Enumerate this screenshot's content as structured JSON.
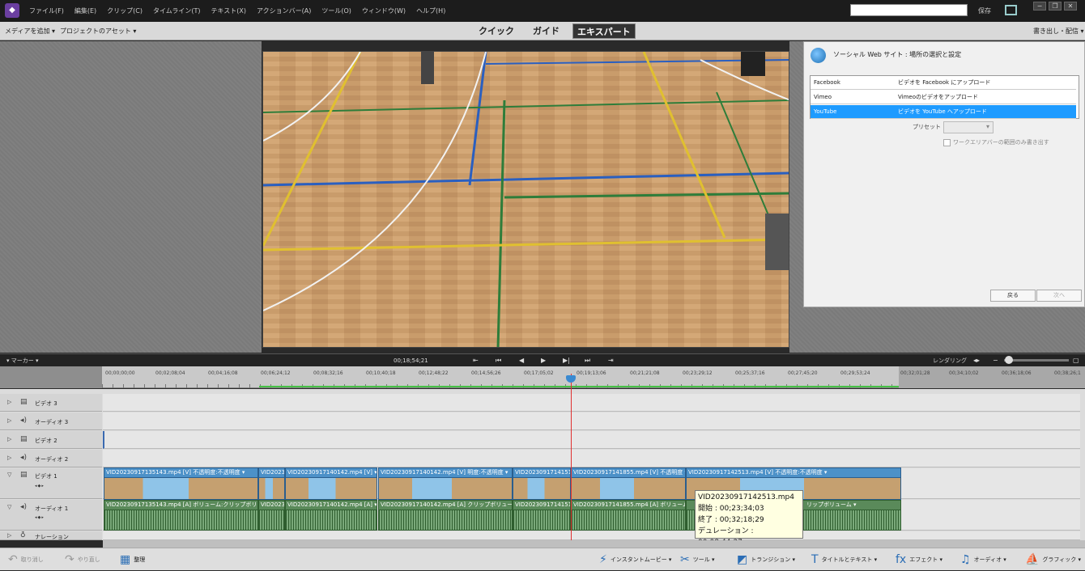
{
  "menubar": {
    "menus": [
      "ファイル(F)",
      "編集(E)",
      "クリップ(C)",
      "タイムライン(T)",
      "テキスト(X)",
      "アクションバー(A)",
      "ツール(O)",
      "ウィンドウ(W)",
      "ヘルプ(H)"
    ],
    "save_label": "保存"
  },
  "toolbar2": {
    "add_media": "メディアを追加 ▾",
    "project_assets": "プロジェクトのアセット ▾",
    "tabs": [
      "クイック",
      "ガイド",
      "エキスパート"
    ],
    "active_tab": "エキスパート",
    "export_share": "書き出し・配信 ▾"
  },
  "export_panel": {
    "title": "ソーシャル Web サイト : 場所の選択と設定",
    "sites": [
      {
        "name": "Facebook",
        "desc": "ビデオを Facebook にアップロード"
      },
      {
        "name": "Vimeo",
        "desc": "Vimeoのビデオをアップロード"
      },
      {
        "name": "YouTube",
        "desc": "ビデオを YouTube へアップロード"
      }
    ],
    "preset_label": "プリセット :",
    "workarea_label": "ワークエリアバーの範囲のみ書き出す",
    "back": "戻る",
    "next": "次へ"
  },
  "timeline_bar": {
    "marker": "▾ マーカー ▾",
    "timecode": "00;18;54;21",
    "render": "レンダリング"
  },
  "ruler": {
    "ticks": [
      "00;00;00;00",
      "00;02;08;04",
      "00;04;16;08",
      "00;06;24;12",
      "00;08;32;16",
      "00;10;40;18",
      "00;12;48;22",
      "00;14;56;26",
      "00;17;05;02",
      "00;19;13;06",
      "00;21;21;08",
      "00;23;29;12",
      "00;25;37;16",
      "00;27;45;20",
      "00;29;53;24",
      "00;32;01;28",
      "00;34;10;02",
      "00;36;18;06",
      "00;38;26;1"
    ]
  },
  "tracks": [
    {
      "label": "ビデオ 3",
      "type": "video"
    },
    {
      "label": "オーディオ 3",
      "type": "audio"
    },
    {
      "label": "ビデオ 2",
      "type": "video"
    },
    {
      "label": "オーディオ 2",
      "type": "audio"
    },
    {
      "label": "ビデオ 1",
      "type": "video"
    },
    {
      "label": "オーディオ 1",
      "type": "audio"
    },
    {
      "label": "ナレーション",
      "type": "narration"
    }
  ],
  "video_clips": [
    "VID20230917135143.mp4 [V] 不透明度:不透明度 ▾",
    "VID2023",
    "VID20230917140142.mp4 [V] ▾",
    "VID20230917140142.mp4 [V] 明度:不透明度 ▾",
    "VID20230917141511",
    "VID20230917141855.mp4 [V] 不透明度 ▾",
    "VID20230917142513.mp4 [V] 不透明度:不透明度 ▾"
  ],
  "audio_clips": [
    "VID20230917135143.mp4 [A] ボリューム:クリップボリューム ▾",
    "VID2023",
    "VID20230917140142.mp4 [A] ▾",
    "VID20230917140142.mp4 [A] クリップボリューム ▾",
    "VID20230917141511",
    "VID20230917141855.mp4 [A] ボリューム ▾",
    "リップボリューム ▾"
  ],
  "tooltip": {
    "file": "VID20230917142513.mp4",
    "start": "開始 : 00;23;34;03",
    "end": "終了 : 00;32;18;29",
    "duration": "デュレーション : 00;08;44;27"
  },
  "bottom_bar": {
    "undo": "取り消し",
    "redo": "やり直し",
    "organize": "整理",
    "instant_movie": "インスタントムービー ▾",
    "tools": "ツール ▾",
    "transitions": "トランジション ▾",
    "titles": "タイトルとテキスト ▾",
    "effects": "エフェクト ▾",
    "audio": "オーディオ ▾",
    "graphics": "グラフィック ▾"
  },
  "colors": {
    "selected": "#1e9bff",
    "playhead": "#e03030",
    "video_clip": "#4c91c8",
    "audio_clip": "#5a8a5a",
    "work_area": "#46c246"
  }
}
